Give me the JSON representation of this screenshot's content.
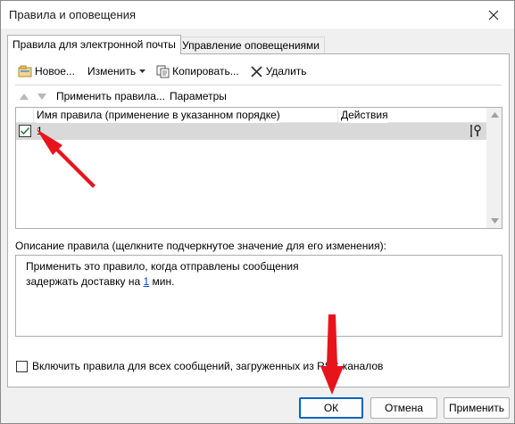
{
  "window": {
    "title": "Правила и оповещения"
  },
  "tabs": [
    {
      "label": "Правила для электронной почты",
      "active": true
    },
    {
      "label": "Управление оповещениями",
      "active": false
    }
  ],
  "toolbar": {
    "new_label": "Новое...",
    "change_label": "Изменить",
    "copy_label": "Копировать...",
    "delete_label": "Удалить"
  },
  "toolbar2": {
    "apply_rules_label": "Применить правила...",
    "options_label": "Параметры"
  },
  "rules_table": {
    "columns": [
      "Имя правила (применение в указанном порядке)",
      "Действия"
    ],
    "rows": [
      {
        "checked": true,
        "name": "1",
        "action_icon": "rule-actions-icon"
      }
    ]
  },
  "description": {
    "label": "Описание правила (щелкните подчеркнутое значение для его изменения):",
    "line1": "Применить это правило, когда отправлены сообщения",
    "line2_before": "задержать доставку на ",
    "line2_link": "1",
    "line2_after": " мин."
  },
  "rss_option": {
    "checked": false,
    "label": "Включить правила для всех сообщений, загруженных из RSS-каналов"
  },
  "buttons": {
    "ok": "ОК",
    "cancel": "Отмена",
    "apply": "Применить"
  },
  "colors": {
    "annotation_arrow": "#e8141c",
    "selected_row": "#d9d9d9",
    "link": "#0044cc",
    "default_button_border": "#0067c0"
  }
}
